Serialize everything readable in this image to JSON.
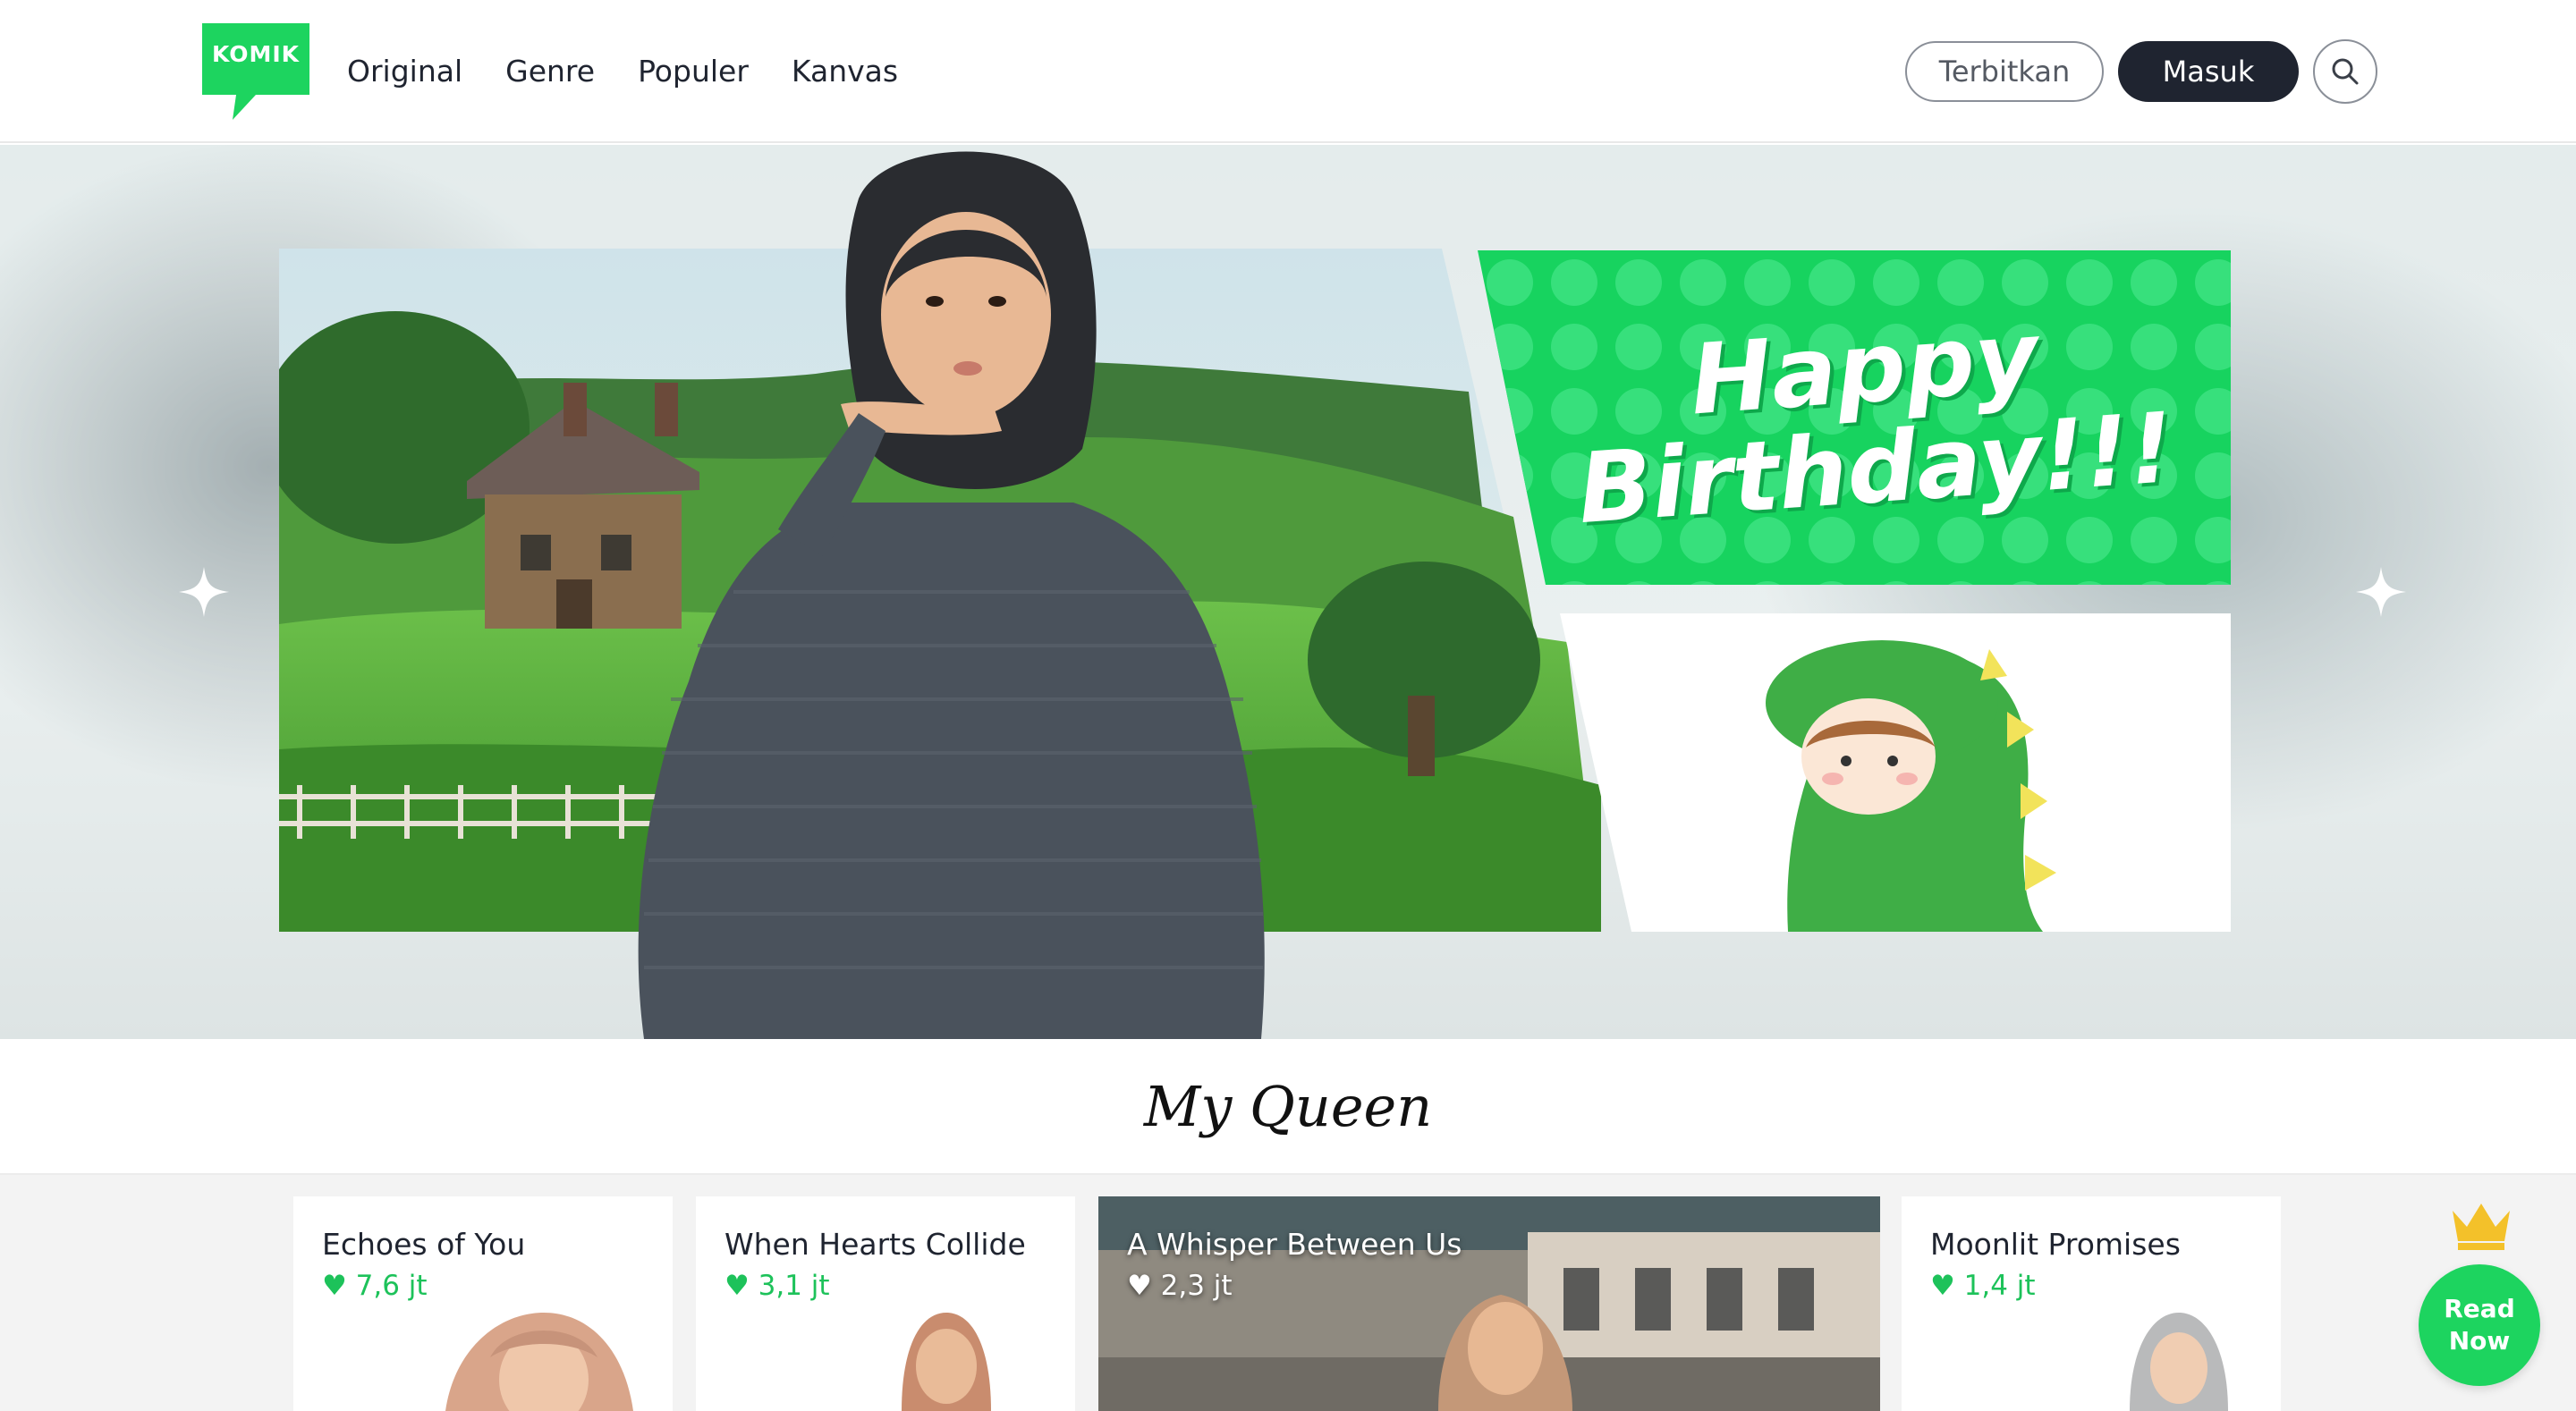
{
  "brand": {
    "logo_text": "KOMIK",
    "accent": "#1dd45f",
    "dark": "#1f2430"
  },
  "nav": {
    "items": [
      "Original",
      "Genre",
      "Populer",
      "Kanvas"
    ]
  },
  "header": {
    "publish_label": "Terbitkan",
    "login_label": "Masuk"
  },
  "hero": {
    "banner_text_line1": "Happy",
    "banner_text_line2": "Birthday!!!"
  },
  "section": {
    "title": "My Queen"
  },
  "cards": [
    {
      "title": "Echoes of You",
      "likes": "♥ 7,6 jt"
    },
    {
      "title": "When Hearts Collide",
      "likes": "♥ 3,1 jt"
    },
    {
      "title": "A Whisper Between Us",
      "likes": "♥ 2,3 jt"
    },
    {
      "title": "Moonlit Promises",
      "likes": "♥ 1,4 jt"
    }
  ],
  "read_now": {
    "line1": "Read",
    "line2": "Now"
  }
}
